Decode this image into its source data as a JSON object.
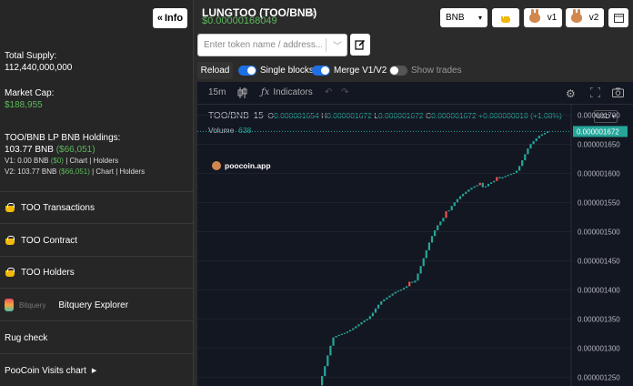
{
  "sidebar": {
    "info_button": "Info",
    "total_supply_label": "Total Supply:",
    "total_supply_value": "112,440,000,000",
    "market_cap_label": "Market Cap:",
    "market_cap_value": "$188,955",
    "lp_holdings_label": "TOO/BNB LP BNB Holdings:",
    "lp_holdings_bnb": "103.77 BNB",
    "lp_holdings_usd": "($66,051)",
    "v1_prefix": "V1: 0.00 BNB",
    "v1_usd": "($0)",
    "v2_prefix": "V2: 103.77 BNB",
    "v2_usd": "($66,051)",
    "sep": "|",
    "chart_link": "Chart",
    "holders_link": "Holders",
    "links": {
      "transactions": "TOO Transactions",
      "contract": "TOO Contract",
      "holders": "TOO Holders",
      "bitquery_small": "Bitquery",
      "bitquery": "Bitquery Explorer",
      "rugcheck": "Rug check",
      "visits": "PooCoin Visits chart"
    }
  },
  "header": {
    "title": "LUNGTOO (TOO/BNB)",
    "price": "$0.00000168049",
    "search_placeholder": "Enter token name / address...",
    "network": "BNB",
    "v1": "v1",
    "v2": "v2"
  },
  "controls": {
    "reload": "Reload",
    "single_blocks": "Single blocks",
    "merge": "Merge V1/V2",
    "show_trades": "Show trades",
    "single_blocks_on": true,
    "merge_on": true,
    "show_trades_on": false
  },
  "chart_toolbar": {
    "interval": "15m",
    "indicators": "Indicators"
  },
  "legend": {
    "symbol": "TOO/BNB",
    "interval": "15",
    "open_label": "O",
    "open": "0.000001654",
    "high_label": "H",
    "high": "0.000001672",
    "low_label": "L",
    "low": "0.000001672",
    "close_label": "C",
    "close": "0.000001672",
    "change": "+0.000000018 (+1.08%)",
    "volume_label": "Volume",
    "volume": "638",
    "currency": "USD",
    "watermark": "poocoin.app"
  },
  "chart_data": {
    "type": "candlestick",
    "y_ticks": [
      "0.000001700",
      "0.000001650",
      "0.000001600",
      "0.000001550",
      "0.000001500",
      "0.000001450",
      "0.000001400",
      "0.000001350",
      "0.000001300",
      "0.000001250"
    ],
    "last_price_label": "0.000001672",
    "last_price": 1.672e-06,
    "ylim": [
      1.235e-06,
      1.718e-06
    ],
    "close_path": [
      [
        0.0,
        1.236e-06
      ],
      [
        0.02,
        1.262e-06
      ],
      [
        0.04,
        1.292e-06
      ],
      [
        0.06,
        1.318e-06
      ],
      [
        0.08,
        1.322e-06
      ],
      [
        0.11,
        1.326e-06
      ],
      [
        0.14,
        1.332e-06
      ],
      [
        0.17,
        1.34e-06
      ],
      [
        0.19,
        1.346e-06
      ],
      [
        0.21,
        1.35e-06
      ],
      [
        0.23,
        1.358e-06
      ],
      [
        0.25,
        1.37e-06
      ],
      [
        0.27,
        1.38e-06
      ],
      [
        0.3,
        1.388e-06
      ],
      [
        0.33,
        1.396e-06
      ],
      [
        0.36,
        1.401e-06
      ],
      [
        0.39,
        1.408e-06
      ],
      [
        0.42,
        1.416e-06
      ],
      [
        0.44,
        1.436e-06
      ],
      [
        0.46,
        1.458e-06
      ],
      [
        0.48,
        1.48e-06
      ],
      [
        0.5,
        1.498e-06
      ],
      [
        0.52,
        1.512e-06
      ],
      [
        0.54,
        1.522e-06
      ],
      [
        0.56,
        1.532e-06
      ],
      [
        0.58,
        1.544e-06
      ],
      [
        0.6,
        1.554e-06
      ],
      [
        0.62,
        1.562e-06
      ],
      [
        0.64,
        1.568e-06
      ],
      [
        0.66,
        1.574e-06
      ],
      [
        0.68,
        1.578e-06
      ],
      [
        0.7,
        1.581e-06
      ],
      [
        0.72,
        1.575e-06
      ],
      [
        0.74,
        1.582e-06
      ],
      [
        0.77,
        1.588e-06
      ],
      [
        0.8,
        1.593e-06
      ],
      [
        0.83,
        1.598e-06
      ],
      [
        0.86,
        1.602e-06
      ],
      [
        0.88,
        1.615e-06
      ],
      [
        0.9,
        1.632e-06
      ],
      [
        0.92,
        1.648e-06
      ],
      [
        0.94,
        1.656e-06
      ],
      [
        0.96,
        1.664e-06
      ],
      [
        1.0,
        1.672e-06
      ]
    ],
    "up_color": "#26a69a",
    "down_color": "#ef5350"
  }
}
